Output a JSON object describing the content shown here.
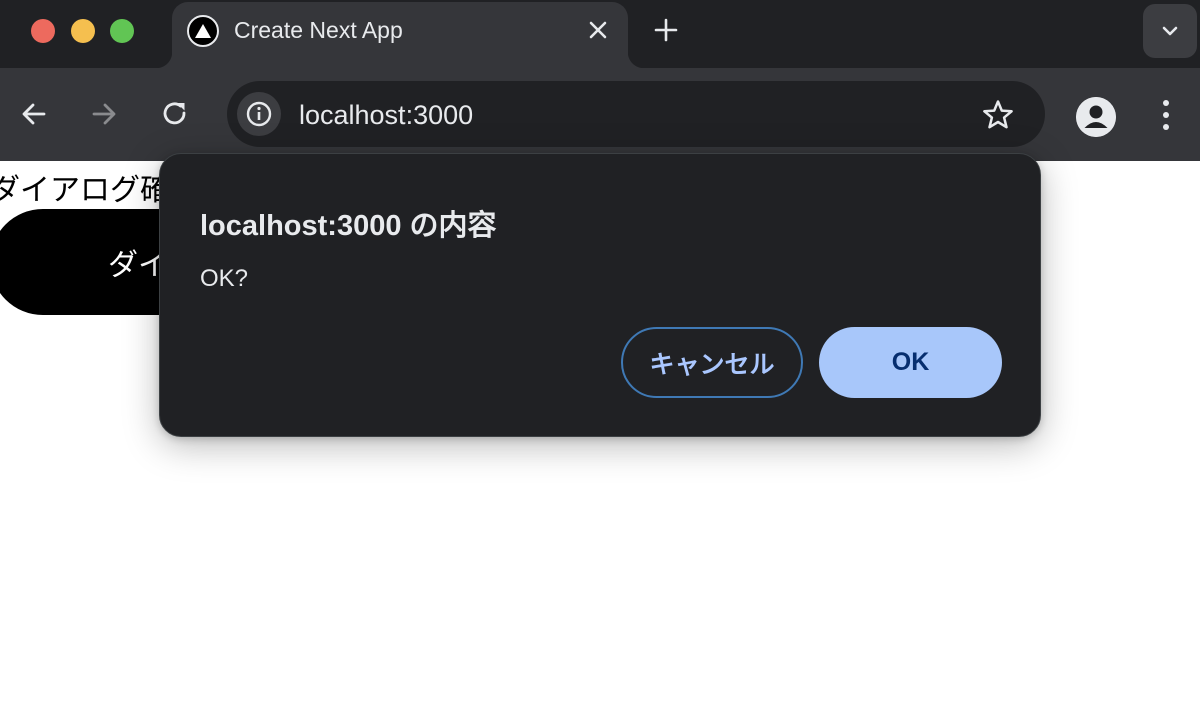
{
  "browser": {
    "tab": {
      "title": "Create Next App",
      "favicon": "triangle-icon"
    },
    "omnibox": {
      "url": "localhost:3000"
    },
    "icons": {
      "back": "arrow-left-icon",
      "forward": "arrow-right-icon",
      "reload": "reload-icon",
      "site_info": "info-icon",
      "bookmark": "star-icon",
      "profile": "person-icon",
      "menu": "kebab-icon",
      "new_tab": "plus-icon",
      "close_tab": "close-icon",
      "tab_search": "chevron-down-icon"
    },
    "colors": {
      "tabstrip": "#202124",
      "toolbar": "#35363a",
      "traffic_red": "#ed6a5e",
      "traffic_yellow": "#f5bf4f",
      "traffic_green": "#61c554"
    }
  },
  "page": {
    "heading": "ダイアログ確",
    "button_label": "ダイ"
  },
  "dialog": {
    "title": "localhost:3000 の内容",
    "message": "OK?",
    "cancel_label": "キャンセル",
    "ok_label": "OK",
    "colors": {
      "background": "#202124",
      "ok_background": "#a8c7fa",
      "ok_text": "#062e6f",
      "cancel_border": "#3f79b5",
      "cancel_text": "#aac7ff"
    }
  }
}
